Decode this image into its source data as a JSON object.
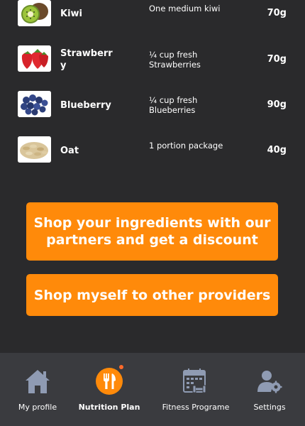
{
  "foods": [
    {
      "name": "Kiwi",
      "portion": "One medium kiwi",
      "amount": "70g",
      "image": "kiwi-image"
    },
    {
      "name": "Strawberry",
      "portion": "¼ cup fresh Strawberries",
      "amount": "70g",
      "image": "strawberry-image"
    },
    {
      "name": "Blueberry",
      "portion": "¼ cup fresh Blueberries",
      "amount": "90g",
      "image": "blueberry-image"
    },
    {
      "name": "Oat",
      "portion": "1 portion package",
      "amount": "40g",
      "image": "oat-image"
    }
  ],
  "actions": {
    "partners_label": "Shop your ingredients with our partners and get a discount",
    "other_label": "Shop myself to other providers"
  },
  "tabbar": {
    "tabs": [
      {
        "label": "My profile",
        "icon": "home-icon",
        "active": false
      },
      {
        "label": "Nutrition Plan",
        "icon": "fork-knife-icon",
        "active": true
      },
      {
        "label": "Fitness Programe",
        "icon": "calendar-dumbbell-icon",
        "active": false
      },
      {
        "label": "Settings",
        "icon": "user-gear-icon",
        "active": false
      }
    ]
  },
  "colors": {
    "background": "#2a2a2c",
    "accent": "#ff8a0a",
    "tabbar": "#3a3b3f",
    "icon_inactive": "#8f9bb3",
    "badge": "#ff6a2a"
  }
}
